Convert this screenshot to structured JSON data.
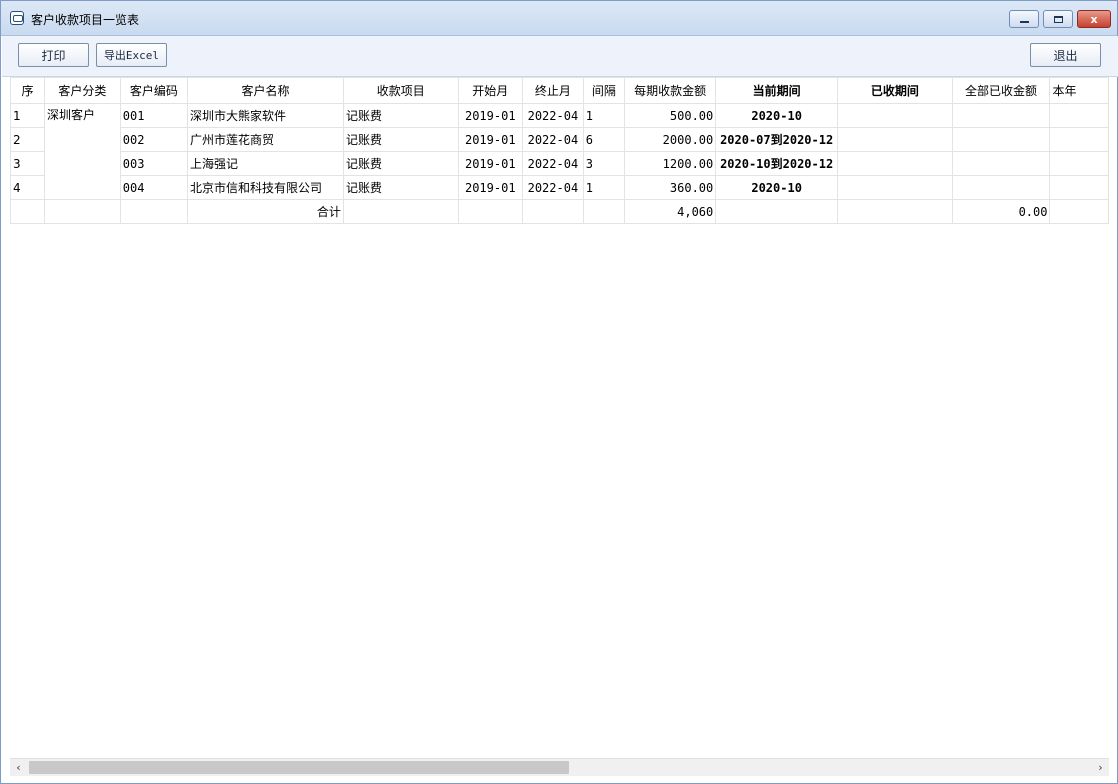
{
  "window": {
    "title": "客户收款项目一览表",
    "minimize_icon": "minimize-icon",
    "maximize_icon": "restore-icon",
    "close_symbol": "x"
  },
  "toolbar": {
    "print_label": "打印",
    "export_label": "导出Excel",
    "exit_label": "退出"
  },
  "table": {
    "headers": [
      "序",
      "客户分类",
      "客户编码",
      "客户名称",
      "收款项目",
      "开始月",
      "终止月",
      "间隔",
      "每期收款金额",
      "当前期间",
      "已收期间",
      "全部已收金额",
      "本年"
    ],
    "rows": [
      {
        "seq": "1",
        "category": "深圳客户",
        "code": "001",
        "name": "深圳市大熊家软件",
        "item": "记账费",
        "start": "2019-01",
        "end": "2022-04",
        "interval": "1",
        "amount": "500.00",
        "period": "2020-10",
        "received_period": "",
        "total_received": "",
        "year": ""
      },
      {
        "seq": "2",
        "category": "",
        "code": "002",
        "name": "广州市莲花商贸",
        "item": "记账费",
        "start": "2019-01",
        "end": "2022-04",
        "interval": "6",
        "amount": "2000.00",
        "period": "2020-07到2020-12",
        "received_period": "",
        "total_received": "",
        "year": ""
      },
      {
        "seq": "3",
        "category": "",
        "code": "003",
        "name": "上海强记",
        "item": "记账费",
        "start": "2019-01",
        "end": "2022-04",
        "interval": "3",
        "amount": "1200.00",
        "period": "2020-10到2020-12",
        "received_period": "",
        "total_received": "",
        "year": ""
      },
      {
        "seq": "4",
        "category": "",
        "code": "004",
        "name": "北京市信和科技有限公司",
        "item": "记账费",
        "start": "2019-01",
        "end": "2022-04",
        "interval": "1",
        "amount": "360.00",
        "period": "2020-10",
        "received_period": "",
        "total_received": "",
        "year": ""
      }
    ],
    "total": {
      "label": "合计",
      "amount": "4,060",
      "total_received": "0.00"
    }
  },
  "scrollbar": {
    "left_arrow": "‹",
    "right_arrow": "›"
  }
}
